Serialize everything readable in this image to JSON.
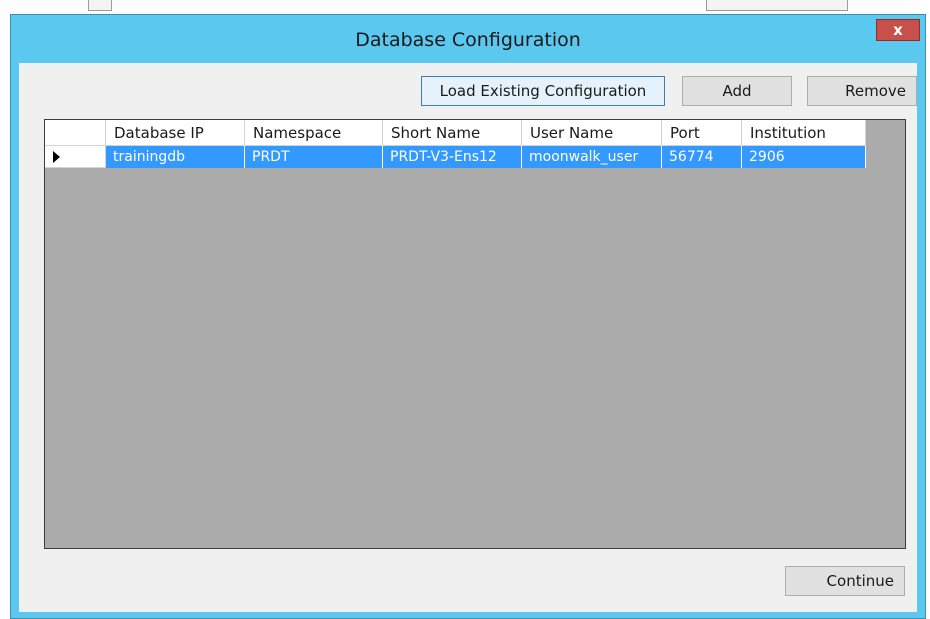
{
  "window": {
    "title": "Database Configuration",
    "close_label": "x"
  },
  "toolbar": {
    "load_label": "Load Existing Configuration",
    "add_label": "Add",
    "remove_label": "Remove"
  },
  "grid": {
    "columns": [
      "Database IP",
      "Namespace",
      "Short Name",
      "User Name",
      "Port",
      "Institution"
    ],
    "rows": [
      {
        "selected": true,
        "indicator_icon": "current-row-arrow-icon",
        "cells": [
          "trainingdb",
          "PRDT",
          "PRDT-V3-Ens12",
          "moonwalk_user",
          "56774",
          "2906"
        ]
      }
    ]
  },
  "footer": {
    "continue_label": "Continue"
  },
  "colors": {
    "title_bar": "#5bc8f0",
    "close_button": "#c7504a",
    "selection": "#3399ff",
    "grid_background": "#ababab"
  }
}
